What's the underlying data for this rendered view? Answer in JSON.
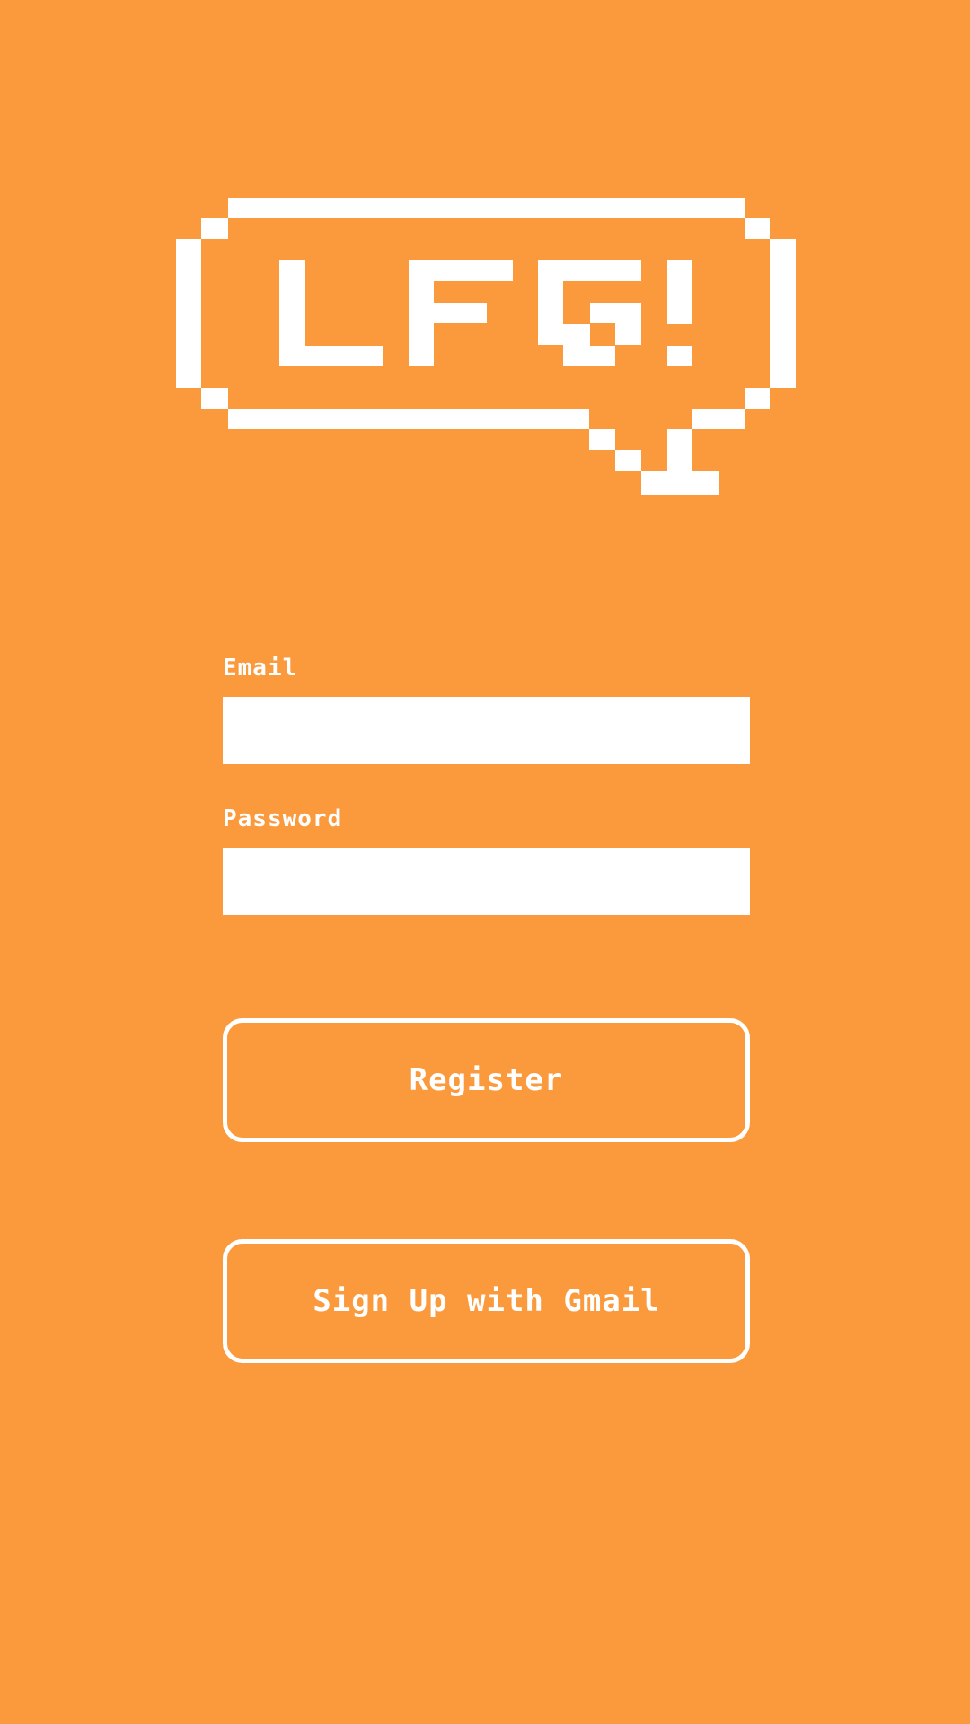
{
  "theme": {
    "background": "#FB9A3C",
    "foreground": "#FFFFFF"
  },
  "logo": {
    "text": "LFG!"
  },
  "form": {
    "email_label": "Email",
    "email_value": "",
    "password_label": "Password",
    "password_value": ""
  },
  "actions": {
    "register_label": "Register",
    "gmail_label": "Sign Up with Gmail"
  }
}
